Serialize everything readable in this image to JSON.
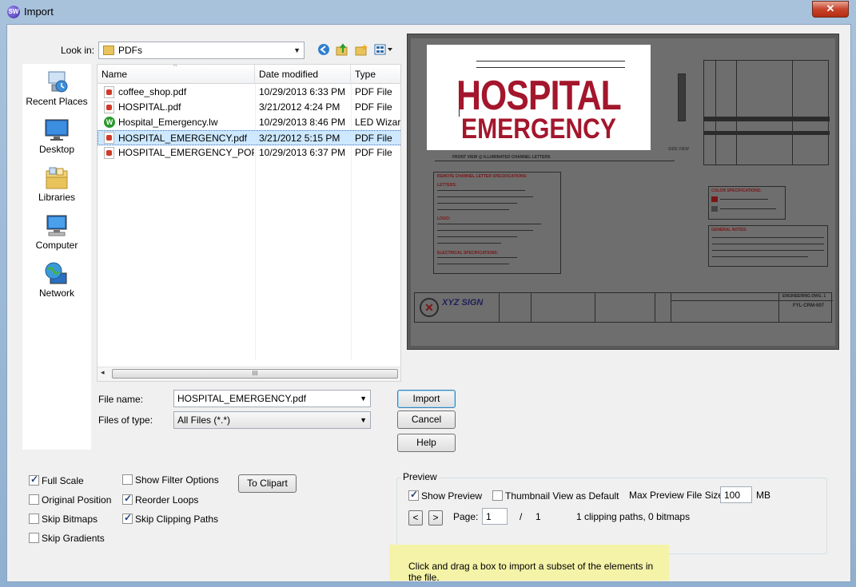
{
  "window": {
    "title": "Import",
    "app_icon": "SW",
    "close_glyph": "✕"
  },
  "lookin": {
    "label": "Look in:",
    "value": "PDFs"
  },
  "places": [
    {
      "label": "Recent Places",
      "icon": "recent-places-icon"
    },
    {
      "label": "Desktop",
      "icon": "desktop-icon"
    },
    {
      "label": "Libraries",
      "icon": "libraries-icon"
    },
    {
      "label": "Computer",
      "icon": "computer-icon"
    },
    {
      "label": "Network",
      "icon": "network-icon"
    }
  ],
  "columns": {
    "name": "Name",
    "date": "Date modified",
    "type": "Type"
  },
  "files": [
    {
      "name": "coffee_shop.pdf",
      "date": "10/29/2013 6:33 PM",
      "type": "PDF File",
      "icon": "pdf-icon",
      "selected": false
    },
    {
      "name": "HOSPITAL.pdf",
      "date": "3/21/2012 4:24 PM",
      "type": "PDF File",
      "icon": "pdf-icon",
      "selected": false
    },
    {
      "name": "Hospital_Emergency.lw",
      "date": "10/29/2013 8:46 PM",
      "type": "LED Wizard",
      "icon": "led-wizard-icon",
      "selected": false
    },
    {
      "name": "HOSPITAL_EMERGENCY.pdf",
      "date": "3/21/2012 5:15 PM",
      "type": "PDF File",
      "icon": "pdf-icon",
      "selected": true
    },
    {
      "name": "HOSPITAL_EMERGENCY_POP...",
      "date": "10/29/2013 6:37 PM",
      "type": "PDF File",
      "icon": "pdf-icon",
      "selected": false
    }
  ],
  "scroll_grip": "III",
  "filename": {
    "label": "File name:",
    "value": "HOSPITAL_EMERGENCY.pdf"
  },
  "filetype": {
    "label": "Files of type:",
    "value": "All Files (*.*)"
  },
  "buttons": {
    "import": "Import",
    "cancel": "Cancel",
    "help": "Help",
    "to_clipart": "To Clipart"
  },
  "options": {
    "full_scale": {
      "label": "Full Scale",
      "checked": true
    },
    "original_position": {
      "label": "Original Position",
      "checked": false
    },
    "skip_bitmaps": {
      "label": "Skip Bitmaps",
      "checked": false
    },
    "skip_gradients": {
      "label": "Skip Gradients",
      "checked": false
    },
    "show_filter_options": {
      "label": "Show Filter Options",
      "checked": false
    },
    "reorder_loops": {
      "label": "Reorder Loops",
      "checked": true
    },
    "skip_clipping_paths": {
      "label": "Skip Clipping Paths",
      "checked": true
    }
  },
  "preview": {
    "group_label": "Preview",
    "show_preview": {
      "label": "Show Preview",
      "checked": true
    },
    "thumbnail_default": {
      "label": "Thumbnail View as Default",
      "checked": false
    },
    "max_size_label": "Max Preview File Size:",
    "max_size_value": "100",
    "max_size_unit": "MB",
    "page_label": "Page:",
    "page_value": "1",
    "page_sep": "/",
    "page_total": "1",
    "stats": "1 clipping paths, 0 bitmaps",
    "prev_glyph": "<",
    "next_glyph": ">"
  },
  "drawing": {
    "sign_line1": "HOSPITAL",
    "sign_line2": "EMERGENCY",
    "front_view": "FRONT VIEW @ ILLUMINATED CHANNEL LETTERS",
    "side_view": "SIDE VIEW",
    "spec_title": "REMOTE CHANNEL LETTER SPECIFICATIONS:",
    "letters": "LETTERS:",
    "logo": "LOGO:",
    "electrical": "ELECTRICAL SPECIFICATIONS:",
    "color_spec": "COLOR SPECIFICATIONS:",
    "general_notes": "GENERAL NOTES:",
    "company": "XYZ SIGN",
    "eng_dwg": "ENGINEERING DWG. 1",
    "dwg_no": "FYL-CRM-007"
  },
  "hint": "Click and drag a box to import a subset of the elements in the file."
}
